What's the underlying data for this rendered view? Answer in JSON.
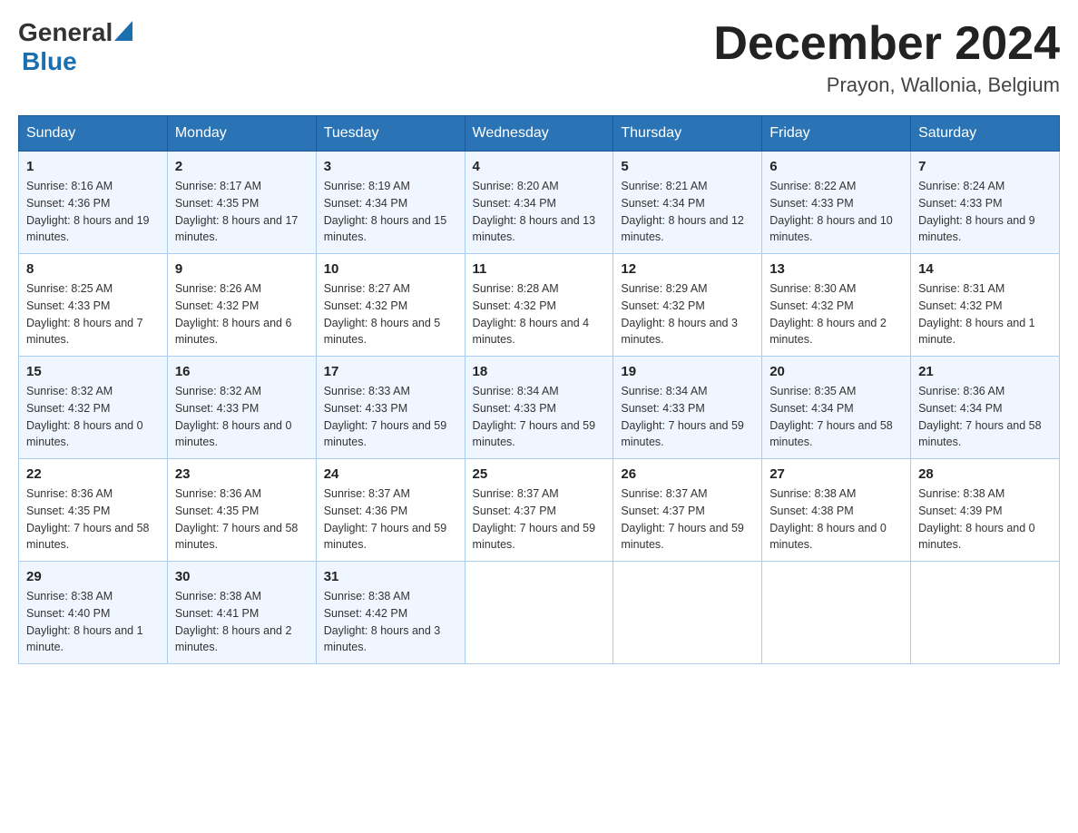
{
  "logo": {
    "general": "General",
    "blue": "Blue"
  },
  "title": {
    "month": "December 2024",
    "location": "Prayon, Wallonia, Belgium"
  },
  "weekdays": [
    "Sunday",
    "Monday",
    "Tuesday",
    "Wednesday",
    "Thursday",
    "Friday",
    "Saturday"
  ],
  "weeks": [
    [
      {
        "day": "1",
        "sunrise": "8:16 AM",
        "sunset": "4:36 PM",
        "daylight": "8 hours and 19 minutes."
      },
      {
        "day": "2",
        "sunrise": "8:17 AM",
        "sunset": "4:35 PM",
        "daylight": "8 hours and 17 minutes."
      },
      {
        "day": "3",
        "sunrise": "8:19 AM",
        "sunset": "4:34 PM",
        "daylight": "8 hours and 15 minutes."
      },
      {
        "day": "4",
        "sunrise": "8:20 AM",
        "sunset": "4:34 PM",
        "daylight": "8 hours and 13 minutes."
      },
      {
        "day": "5",
        "sunrise": "8:21 AM",
        "sunset": "4:34 PM",
        "daylight": "8 hours and 12 minutes."
      },
      {
        "day": "6",
        "sunrise": "8:22 AM",
        "sunset": "4:33 PM",
        "daylight": "8 hours and 10 minutes."
      },
      {
        "day": "7",
        "sunrise": "8:24 AM",
        "sunset": "4:33 PM",
        "daylight": "8 hours and 9 minutes."
      }
    ],
    [
      {
        "day": "8",
        "sunrise": "8:25 AM",
        "sunset": "4:33 PM",
        "daylight": "8 hours and 7 minutes."
      },
      {
        "day": "9",
        "sunrise": "8:26 AM",
        "sunset": "4:32 PM",
        "daylight": "8 hours and 6 minutes."
      },
      {
        "day": "10",
        "sunrise": "8:27 AM",
        "sunset": "4:32 PM",
        "daylight": "8 hours and 5 minutes."
      },
      {
        "day": "11",
        "sunrise": "8:28 AM",
        "sunset": "4:32 PM",
        "daylight": "8 hours and 4 minutes."
      },
      {
        "day": "12",
        "sunrise": "8:29 AM",
        "sunset": "4:32 PM",
        "daylight": "8 hours and 3 minutes."
      },
      {
        "day": "13",
        "sunrise": "8:30 AM",
        "sunset": "4:32 PM",
        "daylight": "8 hours and 2 minutes."
      },
      {
        "day": "14",
        "sunrise": "8:31 AM",
        "sunset": "4:32 PM",
        "daylight": "8 hours and 1 minute."
      }
    ],
    [
      {
        "day": "15",
        "sunrise": "8:32 AM",
        "sunset": "4:32 PM",
        "daylight": "8 hours and 0 minutes."
      },
      {
        "day": "16",
        "sunrise": "8:32 AM",
        "sunset": "4:33 PM",
        "daylight": "8 hours and 0 minutes."
      },
      {
        "day": "17",
        "sunrise": "8:33 AM",
        "sunset": "4:33 PM",
        "daylight": "7 hours and 59 minutes."
      },
      {
        "day": "18",
        "sunrise": "8:34 AM",
        "sunset": "4:33 PM",
        "daylight": "7 hours and 59 minutes."
      },
      {
        "day": "19",
        "sunrise": "8:34 AM",
        "sunset": "4:33 PM",
        "daylight": "7 hours and 59 minutes."
      },
      {
        "day": "20",
        "sunrise": "8:35 AM",
        "sunset": "4:34 PM",
        "daylight": "7 hours and 58 minutes."
      },
      {
        "day": "21",
        "sunrise": "8:36 AM",
        "sunset": "4:34 PM",
        "daylight": "7 hours and 58 minutes."
      }
    ],
    [
      {
        "day": "22",
        "sunrise": "8:36 AM",
        "sunset": "4:35 PM",
        "daylight": "7 hours and 58 minutes."
      },
      {
        "day": "23",
        "sunrise": "8:36 AM",
        "sunset": "4:35 PM",
        "daylight": "7 hours and 58 minutes."
      },
      {
        "day": "24",
        "sunrise": "8:37 AM",
        "sunset": "4:36 PM",
        "daylight": "7 hours and 59 minutes."
      },
      {
        "day": "25",
        "sunrise": "8:37 AM",
        "sunset": "4:37 PM",
        "daylight": "7 hours and 59 minutes."
      },
      {
        "day": "26",
        "sunrise": "8:37 AM",
        "sunset": "4:37 PM",
        "daylight": "7 hours and 59 minutes."
      },
      {
        "day": "27",
        "sunrise": "8:38 AM",
        "sunset": "4:38 PM",
        "daylight": "8 hours and 0 minutes."
      },
      {
        "day": "28",
        "sunrise": "8:38 AM",
        "sunset": "4:39 PM",
        "daylight": "8 hours and 0 minutes."
      }
    ],
    [
      {
        "day": "29",
        "sunrise": "8:38 AM",
        "sunset": "4:40 PM",
        "daylight": "8 hours and 1 minute."
      },
      {
        "day": "30",
        "sunrise": "8:38 AM",
        "sunset": "4:41 PM",
        "daylight": "8 hours and 2 minutes."
      },
      {
        "day": "31",
        "sunrise": "8:38 AM",
        "sunset": "4:42 PM",
        "daylight": "8 hours and 3 minutes."
      },
      null,
      null,
      null,
      null
    ]
  ]
}
